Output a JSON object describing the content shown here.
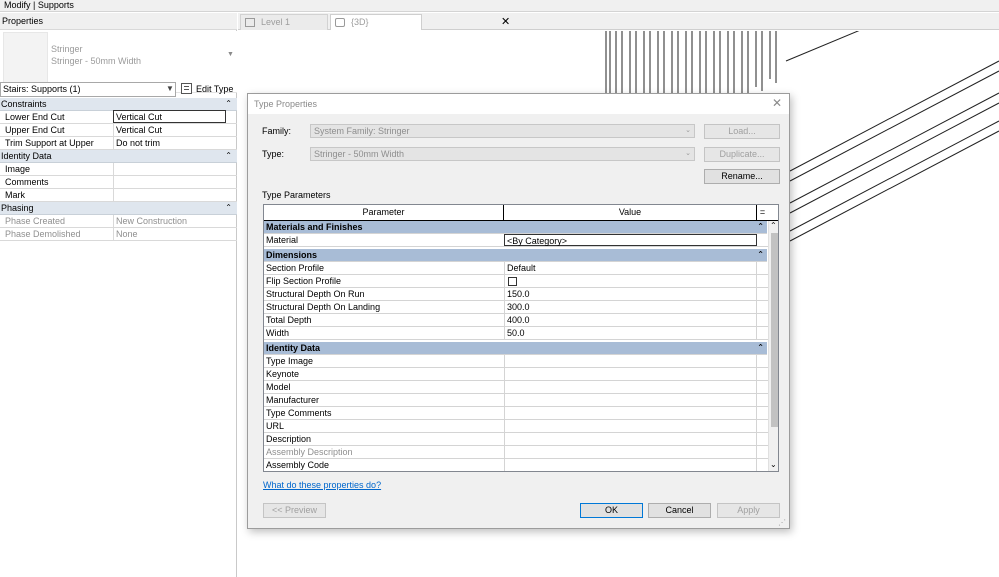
{
  "app": {
    "context_title": "Modify | Supports"
  },
  "properties_panel": {
    "title": "Properties",
    "type_selector": {
      "family": "Stringer",
      "type": "Stringer - 50mm Width"
    },
    "instance_filter": "Stairs: Supports (1)",
    "edit_type_label": "Edit Type",
    "groups": [
      {
        "name": "Constraints",
        "rows": [
          {
            "key": "Lower End Cut",
            "value": "Vertical Cut"
          },
          {
            "key": "Upper End Cut",
            "value": "Vertical Cut"
          },
          {
            "key": "Trim Support at Upper",
            "value": "Do not trim"
          }
        ]
      },
      {
        "name": "Identity Data",
        "rows": [
          {
            "key": "Image",
            "value": ""
          },
          {
            "key": "Comments",
            "value": ""
          },
          {
            "key": "Mark",
            "value": ""
          }
        ]
      },
      {
        "name": "Phasing",
        "rows": [
          {
            "key": "Phase Created",
            "value": "New Construction"
          },
          {
            "key": "Phase Demolished",
            "value": "None"
          }
        ]
      }
    ]
  },
  "view_tabs": [
    {
      "label": "Level 1",
      "icon": "floor-plan-icon"
    },
    {
      "label": "{3D}",
      "icon": "cube-3d-icon"
    }
  ],
  "dialog": {
    "title": "Type Properties",
    "family_label": "Family:",
    "family_value": "System Family: Stringer",
    "type_label": "Type:",
    "type_value": "Stringer - 50mm Width",
    "load_label": "Load...",
    "duplicate_label": "Duplicate...",
    "rename_label": "Rename...",
    "type_parameters_label": "Type Parameters",
    "columns": {
      "parameter": "Parameter",
      "value": "Value",
      "corner": "="
    },
    "groups": [
      {
        "name": "Materials and Finishes",
        "rows": [
          {
            "key": "Material",
            "value": "<By Category>"
          }
        ]
      },
      {
        "name": "Dimensions",
        "rows": [
          {
            "key": "Section Profile",
            "value": "Default"
          },
          {
            "key": "Flip Section Profile",
            "value": ""
          },
          {
            "key": "Structural Depth On Run",
            "value": "150.0"
          },
          {
            "key": "Structural Depth On Landing",
            "value": "300.0"
          },
          {
            "key": "Total Depth",
            "value": "400.0"
          },
          {
            "key": "Width",
            "value": "50.0"
          }
        ]
      },
      {
        "name": "Identity Data",
        "rows": [
          {
            "key": "Type Image",
            "value": ""
          },
          {
            "key": "Keynote",
            "value": ""
          },
          {
            "key": "Model",
            "value": ""
          },
          {
            "key": "Manufacturer",
            "value": ""
          },
          {
            "key": "Type Comments",
            "value": ""
          },
          {
            "key": "URL",
            "value": ""
          },
          {
            "key": "Description",
            "value": ""
          },
          {
            "key": "Assembly Description",
            "value": ""
          },
          {
            "key": "Assembly Code",
            "value": ""
          }
        ]
      }
    ],
    "help_link": "What do these properties do?",
    "preview_label": "<< Preview",
    "ok_label": "OK",
    "cancel_label": "Cancel",
    "apply_label": "Apply"
  }
}
